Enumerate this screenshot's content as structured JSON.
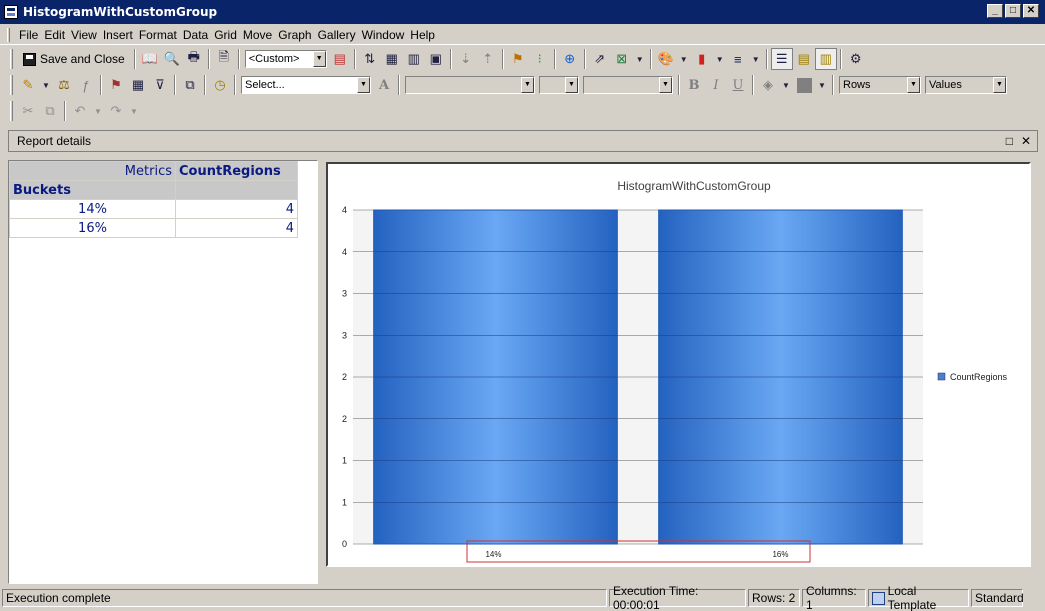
{
  "window": {
    "title": "HistogramWithCustomGroup"
  },
  "menu": [
    "File",
    "Edit",
    "View",
    "Insert",
    "Format",
    "Data",
    "Grid",
    "Move",
    "Graph",
    "Gallery",
    "Window",
    "Help"
  ],
  "toolbar1": {
    "save_close": "Save and Close",
    "view_combo": "<Custom>"
  },
  "toolbar2": {
    "select_combo": "Select...",
    "rows_combo": "Rows",
    "values_combo": "Values"
  },
  "panel": {
    "title": "Report details"
  },
  "grid": {
    "metrics_label": "Metrics",
    "metric_name": "CountRegions",
    "row_header": "Buckets",
    "rows": [
      {
        "bucket": "14%",
        "value": "4"
      },
      {
        "bucket": "16%",
        "value": "4"
      }
    ]
  },
  "chart_data": {
    "type": "bar",
    "title": "HistogramWithCustomGroup",
    "categories": [
      "14%",
      "16%"
    ],
    "series": [
      {
        "name": "CountRegions",
        "values": [
          4,
          4
        ]
      }
    ],
    "y_tick_labels": [
      "0",
      "1",
      "1",
      "2",
      "2",
      "3",
      "3",
      "4",
      "4"
    ],
    "ylim": [
      0,
      4
    ],
    "grid": true,
    "legend": "right",
    "colors": {
      "bar": "#3a7ad8",
      "bar_edge": "#1e5ab4",
      "legend_swatch": "#4a7fd0",
      "category_box": "#cc3333"
    }
  },
  "status": {
    "message": "Execution complete",
    "exec_time": "Execution Time: 00:00:01",
    "rows": "Rows: 2",
    "columns": "Columns: 1",
    "template": "Local Template",
    "mode": "Standard"
  }
}
